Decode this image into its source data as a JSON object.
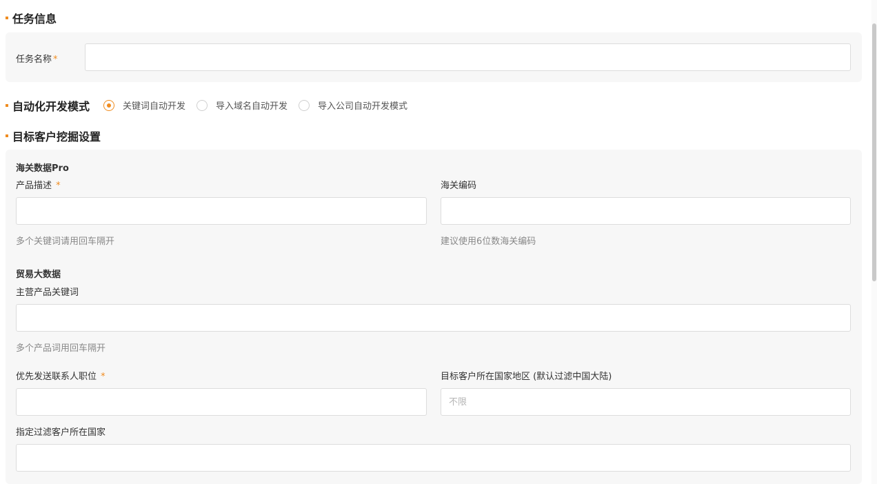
{
  "task_info": {
    "title": "任务信息",
    "name_label": "任务名称",
    "required_mark": "*",
    "name_value": ""
  },
  "mode": {
    "title": "自动化开发模式",
    "options": [
      {
        "label": "关键词自动开发",
        "checked": true
      },
      {
        "label": "导入域名自动开发",
        "checked": false
      },
      {
        "label": "导入公司自动开发模式",
        "checked": false
      }
    ]
  },
  "target": {
    "title": "目标客户挖掘设置",
    "customs": {
      "title": "海关数据Pro",
      "product_label": "产品描述",
      "required_mark": "*",
      "product_value": "",
      "product_hint": "多个关键词请用回车隔开",
      "hs_label": "海关编码",
      "hs_value": "",
      "hs_hint": "建议使用6位数海关编码"
    },
    "trade": {
      "title": "贸易大数据",
      "keywords_label": "主营产品关键词",
      "keywords_value": "",
      "keywords_hint": "多个产品词用回车隔开",
      "position_label": "优先发送联系人职位",
      "required_mark": "*",
      "position_value": "",
      "country_label": "目标客户所在国家地区 (默认过滤中国大陆)",
      "country_placeholder": "不限",
      "filter_label": "指定过滤客户所在国家",
      "filter_value": ""
    }
  },
  "colors": {
    "accent": "#f08c1f",
    "panel_bg": "#f7f7f7",
    "border": "#dcdcdc"
  }
}
